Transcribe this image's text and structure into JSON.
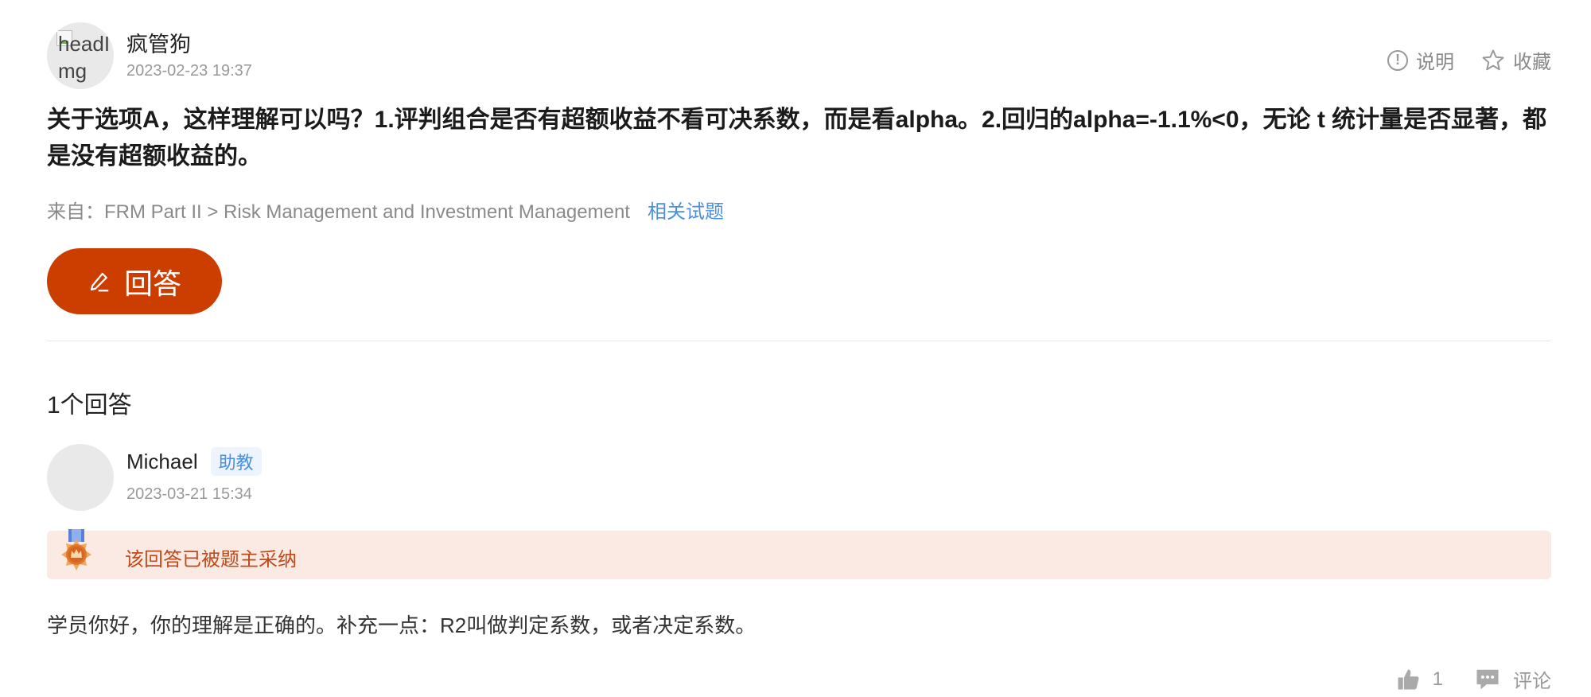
{
  "question": {
    "avatar_alt": "headImg",
    "author": "疯管狗",
    "time": "2023-02-23 19:37",
    "actions": {
      "explain": "说明",
      "favorite": "收藏"
    },
    "title": "关于选项A，这样理解可以吗？1.评判组合是否有超额收益不看可决系数，而是看alpha。2.回归的alpha=-1.1%<0，无论 t 统计量是否显著，都是没有超额收益的。",
    "source_prefix": "来自：",
    "source_path": "FRM Part II > Risk Management and Investment Management",
    "related_link": "相关试题",
    "answer_button": "回答"
  },
  "answers_count_label": "1个回答",
  "answer": {
    "author": "Michael",
    "role_badge": "助教",
    "time": "2023-03-21 15:34",
    "adopted_notice": "该回答已被题主采纳",
    "body": "学员你好，你的理解是正确的。补充一点：R2叫做判定系数，或者决定系数。",
    "like_count": "1",
    "comment_label": "评论"
  },
  "colors": {
    "primary": "#cc3d00",
    "link": "#4a90e2",
    "adopted_bg": "#fbeae3"
  }
}
